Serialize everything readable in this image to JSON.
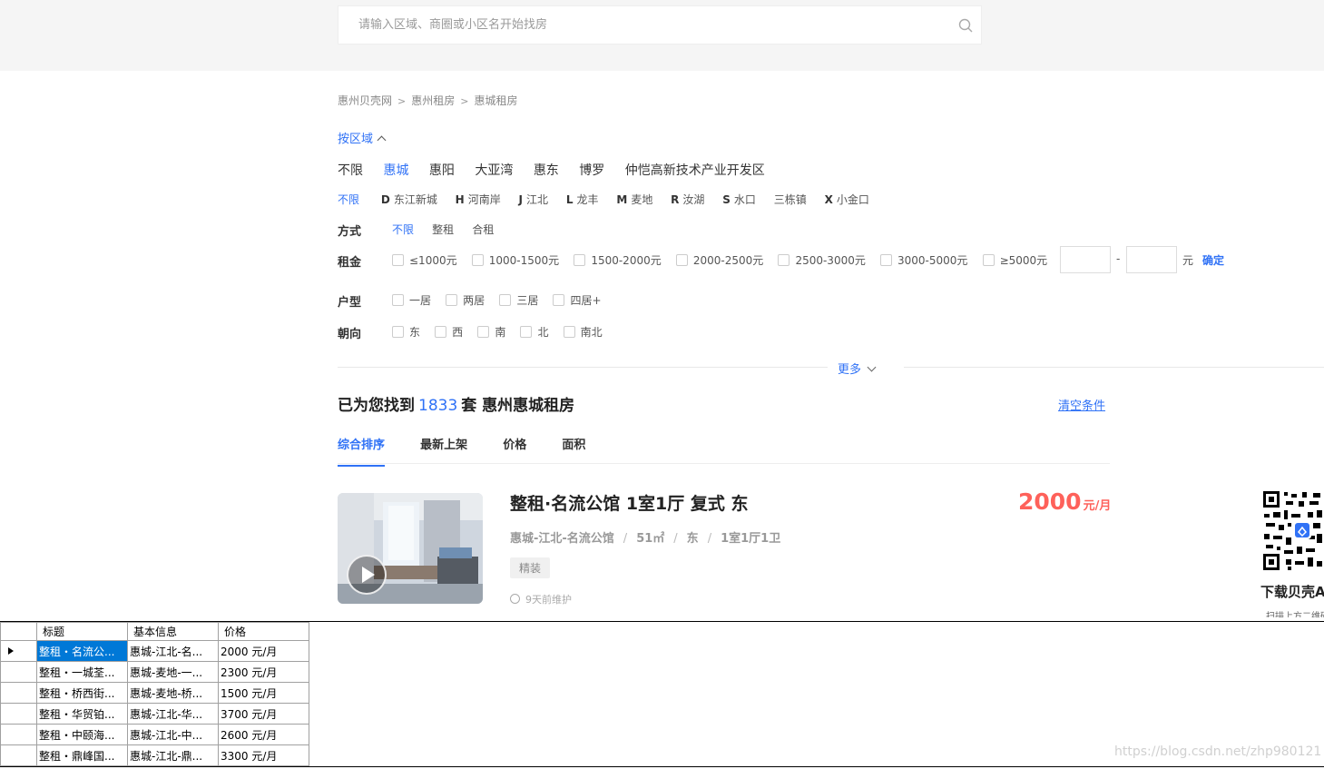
{
  "search": {
    "placeholder": "请输入区域、商圈或小区名开始找房"
  },
  "breadcrumb": [
    "惠州贝壳网",
    "惠州租房",
    "惠城租房"
  ],
  "breadcrumb_sep": ">",
  "filters": {
    "toggle_label": "按区域",
    "regions": [
      "不限",
      "惠城",
      "惠阳",
      "大亚湾",
      "惠东",
      "博罗",
      "仲恺高新技术产业开发区"
    ],
    "active_region": "惠城",
    "subareas_any": "不限",
    "subareas": [
      {
        "letter": "D",
        "name": "东江新城"
      },
      {
        "letter": "H",
        "name": "河南岸"
      },
      {
        "letter": "J",
        "name": "江北"
      },
      {
        "letter": "L",
        "name": "龙丰"
      },
      {
        "letter": "M",
        "name": "麦地"
      },
      {
        "letter": "R",
        "name": "汝湖"
      },
      {
        "letter": "S",
        "name": "水口"
      },
      {
        "letter": "",
        "name": "三栋镇"
      },
      {
        "letter": "X",
        "name": "小金口"
      }
    ],
    "mode_label": "方式",
    "modes": [
      "不限",
      "整租",
      "合租"
    ],
    "rent_label": "租金",
    "rent_ranges": [
      "≤1000元",
      "1000-1500元",
      "1500-2000元",
      "2000-2500元",
      "2500-3000元",
      "3000-5000元",
      "≥5000元"
    ],
    "rent_dash": "-",
    "rent_unit": "元",
    "rent_confirm": "确定",
    "layout_label": "户型",
    "layouts": [
      "一居",
      "两居",
      "三居",
      "四居+"
    ],
    "direction_label": "朝向",
    "directions": [
      "东",
      "西",
      "南",
      "北",
      "南北"
    ],
    "more": "更多"
  },
  "result": {
    "prefix": "已为您找到",
    "count": "1833",
    "suffix": "套 惠州惠城租房",
    "clear": "清空条件"
  },
  "sort_tabs": [
    "综合排序",
    "最新上架",
    "价格",
    "面积"
  ],
  "listing": {
    "title": "整租·名流公馆 1室1厅 复式 东",
    "price": "2000",
    "price_unit": "元/月",
    "info": [
      "惠城-江北-名流公馆",
      "51㎡",
      "东",
      "1室1厅1卫"
    ],
    "tag": "精装",
    "time": "9天前维护"
  },
  "sidebar": {
    "qr_title": "下载贝壳App",
    "qr_sub": "扫描上方二维码"
  },
  "grid": {
    "headers": [
      "标题",
      "基本信息",
      "价格"
    ],
    "rows": [
      [
        "整租・名流公...",
        "惠城-江北-名...",
        "2000 元/月"
      ],
      [
        "整租・一城荃...",
        "惠城-麦地-一...",
        "2300 元/月"
      ],
      [
        "整租・桥西街...",
        "惠城-麦地-桥...",
        "1500 元/月"
      ],
      [
        "整租・华贸铂...",
        "惠城-江北-华...",
        "3700 元/月"
      ],
      [
        "整租・中颐海...",
        "惠城-江北-中...",
        "2600 元/月"
      ],
      [
        "整租・鼎峰国...",
        "惠城-江北-鼎...",
        "3300 元/月"
      ]
    ]
  },
  "watermark": "https://blog.csdn.net/zhp980121",
  "colors": {
    "accent": "#3072f6",
    "price": "#fe615a",
    "grid_selection": "#0078d7"
  }
}
